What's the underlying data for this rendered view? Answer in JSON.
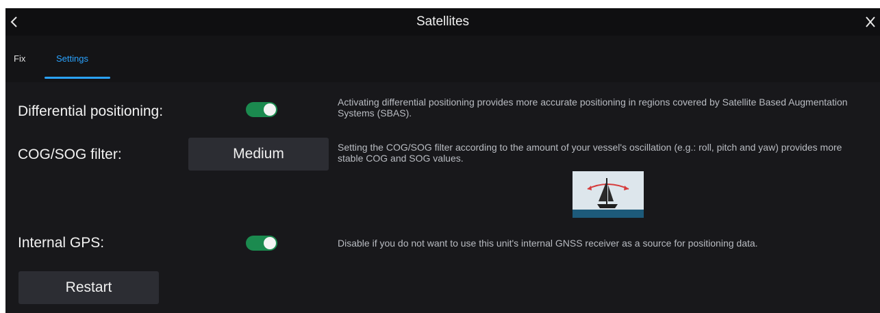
{
  "titlebar": {
    "title": "Satellites",
    "back_icon": "chevron-left-icon",
    "close_icon": "close-icon"
  },
  "tabs": [
    {
      "label": "Fix",
      "active": false
    },
    {
      "label": "Settings",
      "active": true
    }
  ],
  "settings": {
    "differential": {
      "label": "Differential positioning:",
      "enabled": true,
      "description": "Activating differential positioning provides more accurate positioning in regions covered by Satellite Based Augmentation Systems (SBAS)."
    },
    "cog_sog": {
      "label": "COG/SOG filter:",
      "value": "Medium",
      "description": "Setting the COG/SOG filter according to the amount of your vessel's oscillation (e.g.: roll, pitch and yaw) provides more stable COG and SOG values."
    },
    "internal_gps": {
      "label": "Internal GPS:",
      "enabled": true,
      "description": "Disable if you do not want to use this unit's internal GNSS receiver as a source for positioning data."
    },
    "restart_label": "Restart"
  },
  "colors": {
    "accent": "#2aa3ff",
    "toggle_on": "#1b8a4f",
    "background": "#18181b"
  }
}
